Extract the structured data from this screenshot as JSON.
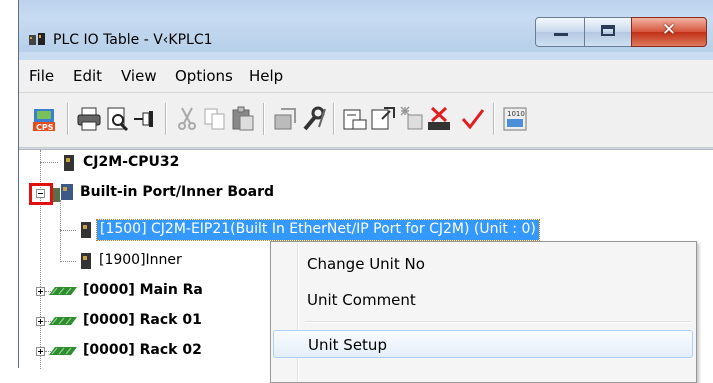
{
  "window": {
    "title": "PLC IO Table - V‹KPLC1",
    "controls": {
      "minimize_icon": "minimize-icon",
      "maximize_icon": "maximize-icon",
      "close_icon": "close-icon"
    }
  },
  "menubar": {
    "items": [
      "File",
      "Edit",
      "View",
      "Options",
      "Help"
    ]
  },
  "toolbar": {
    "icons": [
      "cps-icon",
      "print-icon",
      "print-preview-icon",
      "pin-icon",
      "cut-icon",
      "copy-icon",
      "paste-icon",
      "unit-icon",
      "wrench-icon",
      "compare-icon",
      "transfer-icon",
      "transfer-from-icon",
      "delete-icon",
      "check-icon",
      "io-icon"
    ]
  },
  "tree": {
    "rows": [
      {
        "label": "CJ2M-CPU32"
      },
      {
        "label": "Built-in Port/Inner Board"
      },
      {
        "label": "[1500] CJ2M-EIP21(Built In EtherNet/IP Port for CJ2M) (Unit : 0)"
      },
      {
        "label": "[1900]Inner"
      },
      {
        "label": "[0000] Main Ra"
      },
      {
        "label": "[0000] Rack 01"
      },
      {
        "label": "[0000] Rack 02"
      }
    ]
  },
  "context_menu": {
    "items": [
      "Change Unit No",
      "Unit Comment",
      "Unit Setup"
    ]
  },
  "colors": {
    "selection": "#3399ff",
    "highlight_box": "#e01010"
  }
}
